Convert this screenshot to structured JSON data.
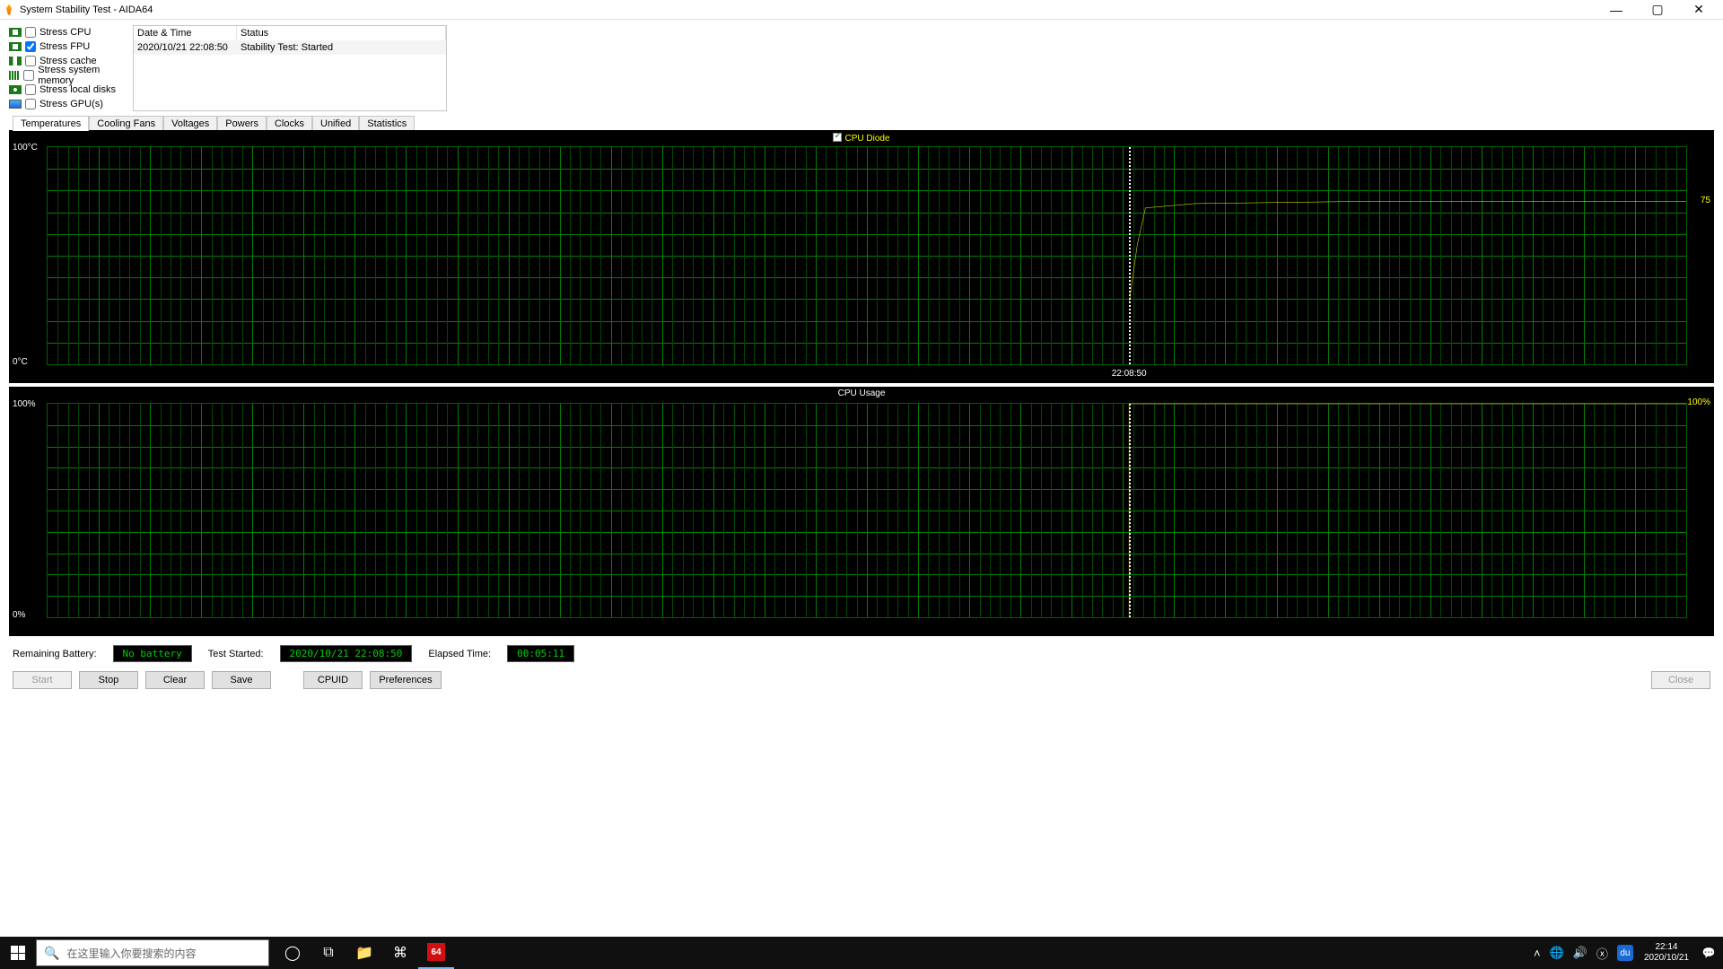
{
  "window_title": "System Stability Test - AIDA64",
  "stress_options": [
    {
      "label": "Stress CPU",
      "checked": false,
      "icon": "cpu"
    },
    {
      "label": "Stress FPU",
      "checked": true,
      "icon": "cpu"
    },
    {
      "label": "Stress cache",
      "checked": false,
      "icon": "bar"
    },
    {
      "label": "Stress system memory",
      "checked": false,
      "icon": "ram"
    },
    {
      "label": "Stress local disks",
      "checked": false,
      "icon": "disk"
    },
    {
      "label": "Stress GPU(s)",
      "checked": false,
      "icon": "mon"
    }
  ],
  "log": {
    "col_datetime": "Date & Time",
    "col_status": "Status",
    "rows": [
      {
        "datetime": "2020/10/21 22:08:50",
        "status": "Stability Test: Started"
      }
    ]
  },
  "tabs": [
    "Temperatures",
    "Cooling Fans",
    "Voltages",
    "Powers",
    "Clocks",
    "Unified",
    "Statistics"
  ],
  "active_tab": "Temperatures",
  "chart_data": [
    {
      "type": "line",
      "title": "CPU Diode",
      "title_checkbox": true,
      "y_top": "100°C",
      "y_bottom": "0°C",
      "current_value_label": "75",
      "current_value_pct": 75,
      "marker_time": "22:08:50",
      "marker_x_pct": 66,
      "series": [
        {
          "name": "CPU Diode",
          "color": "#ffff00",
          "points": [
            [
              66,
              28
            ],
            [
              66.5,
              55
            ],
            [
              67,
              72
            ],
            [
              70,
              74
            ],
            [
              80,
              75
            ],
            [
              90,
              75
            ],
            [
              100,
              75
            ]
          ]
        }
      ],
      "ylim": [
        0,
        100
      ]
    },
    {
      "type": "line",
      "title": "CPU Usage",
      "title_checkbox": false,
      "y_top": "100%",
      "y_bottom": "0%",
      "current_value_label": "100%",
      "current_value_pct": 100,
      "marker_time": "",
      "marker_x_pct": 66,
      "series": [
        {
          "name": "CPU Usage",
          "color": "#ffff00",
          "points": [
            [
              66,
              0
            ],
            [
              66,
              100
            ],
            [
              100,
              100
            ]
          ]
        }
      ],
      "ylim": [
        0,
        100
      ]
    }
  ],
  "status": {
    "battery_label": "Remaining Battery:",
    "battery_value": "No battery",
    "started_label": "Test Started:",
    "started_value": "2020/10/21 22:08:50",
    "elapsed_label": "Elapsed Time:",
    "elapsed_value": "00:05:11"
  },
  "buttons": {
    "start": "Start",
    "stop": "Stop",
    "clear": "Clear",
    "save": "Save",
    "cpuid": "CPUID",
    "prefs": "Preferences",
    "close": "Close"
  },
  "taskbar": {
    "search_placeholder": "在这里输入你要搜索的内容",
    "clock_time": "22:14",
    "clock_date": "2020/10/21",
    "aida_badge": "64",
    "du_badge": "du"
  }
}
